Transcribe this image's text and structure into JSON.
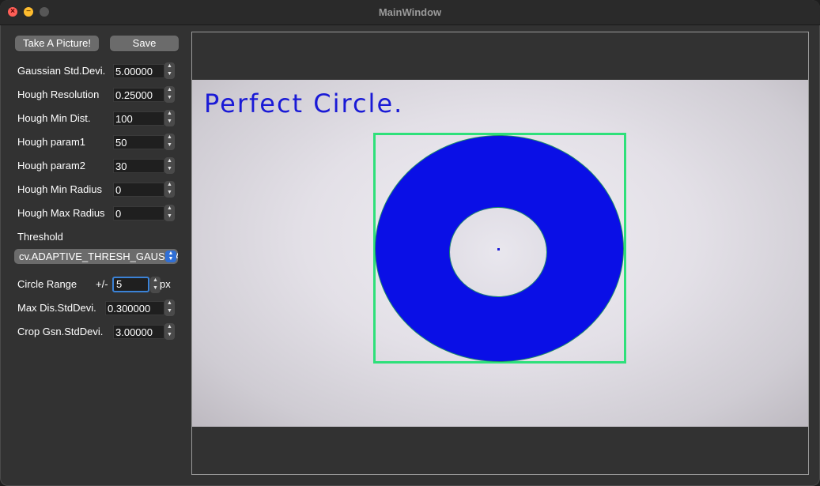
{
  "window": {
    "title": "MainWindow"
  },
  "toolbar": {
    "take_picture_label": "Take A Picture!",
    "save_label": "Save"
  },
  "params": {
    "gaussian": {
      "label": "Gaussian Std.Devi.",
      "value": "5.00000"
    },
    "hough_resolution": {
      "label": "Hough Resolution",
      "value": "0.25000"
    },
    "hough_min_dist": {
      "label": "Hough Min Dist.",
      "value": "100"
    },
    "hough_param1": {
      "label": "Hough param1",
      "value": "50"
    },
    "hough_param2": {
      "label": "Hough param2",
      "value": "30"
    },
    "hough_min_radius": {
      "label": "Hough Min Radius",
      "value": "0"
    },
    "hough_max_radius": {
      "label": "Hough Max Radius",
      "value": "0"
    }
  },
  "threshold": {
    "label": "Threshold",
    "selected": "cv.ADAPTIVE_THRESH_GAUSSIAN_C"
  },
  "circle_range": {
    "label": "Circle Range",
    "prefix": "+/-",
    "value": "5",
    "unit": "px"
  },
  "max_dis": {
    "label": "Max Dis.StdDevi.",
    "value": "0.300000"
  },
  "crop_gsn": {
    "label": "Crop Gsn.StdDevi.",
    "value": "3.00000"
  },
  "viewer": {
    "overlay_text": "Perfect Circle."
  },
  "colors": {
    "ring": "#0a0fe6",
    "bbox": "#2ee07a",
    "overlay_text": "#1a1ad6"
  }
}
